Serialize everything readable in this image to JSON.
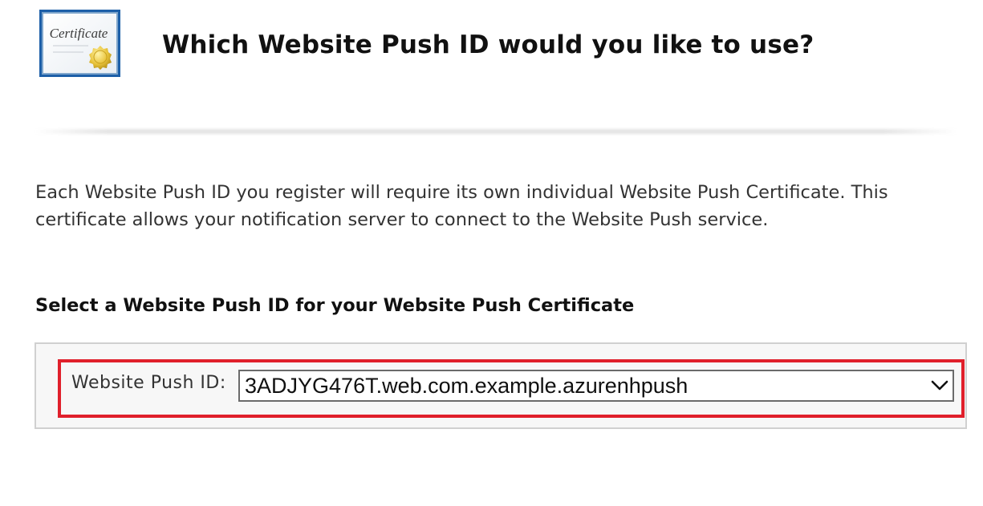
{
  "header": {
    "icon": "certificate-icon",
    "icon_text": "Certificate",
    "title": "Which Website Push ID would you like to use?"
  },
  "intro": {
    "text": "Each Website Push ID you register will require its own individual Website Push Certificate. This certificate allows your notification server to connect to the Website Push service."
  },
  "selection": {
    "heading": "Select a Website Push ID for your Website Push Certificate",
    "field_label": "Website Push ID:",
    "selected_value": "3ADJYG476T.web.com.example.azurenhpush",
    "dropdown_icon": "chevron-down-icon"
  },
  "colors": {
    "highlight": "#e0202b",
    "panel_background": "#f7f7f7",
    "icon_border": "#1d5fa8",
    "seal": "#e8c33a"
  }
}
